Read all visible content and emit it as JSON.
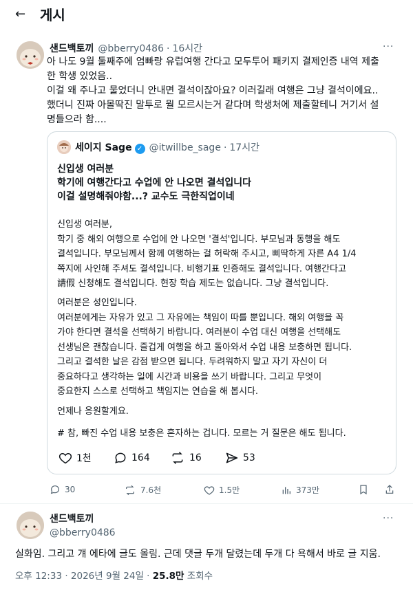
{
  "header": {
    "back_icon": "arrow-left-icon",
    "title": "게시"
  },
  "post1": {
    "name": "샌드백토끼",
    "handle": "@bberry0486",
    "time": "16시간",
    "lines": [
      "아 나도 9월 둘째주에 엄빠랑 유럽여행 간다고 모두투어 패키지 결제인증 내역 제출",
      "한 학생 있었음..",
      "이걸 왜 주나고 물었더니 안내면 결석이잖아요? 이러길래 여행은 그냥 결석이에요..",
      "했더니 진짜 아몰딱진 말투로 뭘 모르시는거 같다며 학생처에 제출할테니 거기서 설",
      "명들으라 함...."
    ]
  },
  "quote": {
    "name": "세이지 Sage",
    "handle": "@itwillbe_sage",
    "time": "17시간",
    "headline": [
      "신입생 여러분",
      "학기에 여행간다고 수업에 안 나오면 결석입니다",
      "이걸 설명해줘야함...? 교수도 극한직업이네"
    ],
    "para1": [
      "신입생 여러분,",
      "학기 중 해외 여행으로 수업에 안 나오면 '결석'입니다. 부모님과 동행을 해도",
      "결석입니다. 부모님께서 함께 여행하는 걸 허락해 주시고, 삐딱하게 자른 A4 1/4",
      "쪽지에 사인해 주셔도 결석입니다. 비행기표 인증해도 결석입니다. 여행간다고",
      "請假 신청해도 결석입니다. 현장 학습 제도는 없습니다. 그냥 결석입니다."
    ],
    "para2": [
      "여러분은 성인입니다.",
      "여러분에게는 자유가 있고 그 자유에는 책임이 따를 뿐입니다. 해외 여행을 꼭",
      "가야 한다면 결석을 선택하기 바랍니다. 여러분이 수업 대신 여행을 선택해도",
      "선생님은 괜찮습니다. 즐겁게 여행을 하고 돌아와서 수업 내용 보충하면 됩니다.",
      "그리고 결석한 날은 감점 받으면 됩니다. 두려워하지 말고 자기 자신이 더",
      "중요하다고 생각하는 일에 시간과 비용을 쓰기 바랍니다. 그리고 무엇이",
      "중요한지 스스로 선택하고 책임지는 연습을 해 봅시다."
    ],
    "para3": "언제나 응원할게요.",
    "para4": "# 참, 빠진 수업 내용 보충은 혼자하는 겁니다. 모르는 거 질문은 해도 됩니다.",
    "actions": {
      "likes": "1천",
      "replies": "164",
      "reposts": "16",
      "shares": "53"
    }
  },
  "post1_actions": {
    "replies": "30",
    "reposts": "7.6천",
    "likes": "1.5만",
    "views": "373만"
  },
  "post2": {
    "name": "샌드백토끼",
    "handle": "@bberry0486",
    "text": "실화임. 그리고 걔 에타에 글도 올림. 근데 댓글 두개 달렸는데 두개 다 욕해서 바로 글 지움.",
    "timestamp": "오후 12:33 · 2026년 9월 24일 · ",
    "views_count": "25.8만",
    "views_label": " 조회수"
  },
  "colors": {
    "text": "#0f1419",
    "muted": "#536471",
    "border": "#cfd9de",
    "verified": "#1d9bf0"
  }
}
